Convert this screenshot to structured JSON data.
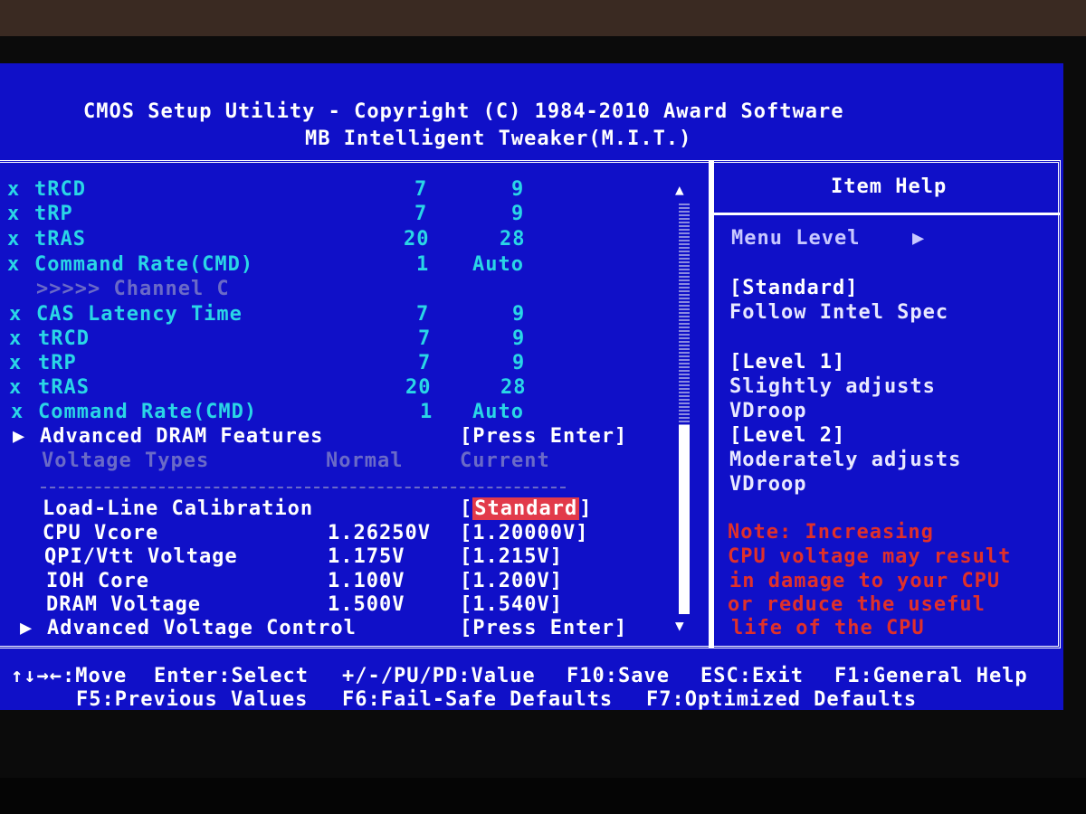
{
  "header": {
    "line1": "CMOS Setup Utility - Copyright (C) 1984-2010 Award Software",
    "line2": "MB Intelligent Tweaker(M.I.T.)"
  },
  "timings_a": [
    {
      "name": "tRCD",
      "normal": "7",
      "current": "9"
    },
    {
      "name": "tRP",
      "normal": "7",
      "current": "9"
    },
    {
      "name": "tRAS",
      "normal": "20",
      "current": "28"
    },
    {
      "name": "Command Rate(CMD)",
      "normal": "1",
      "current": "Auto"
    }
  ],
  "channel_label": ">>>>> Channel C",
  "timings_c": [
    {
      "name": "CAS Latency Time",
      "normal": "7",
      "current": "9"
    },
    {
      "name": "tRCD",
      "normal": "7",
      "current": "9"
    },
    {
      "name": "tRP",
      "normal": "7",
      "current": "9"
    },
    {
      "name": "tRAS",
      "normal": "20",
      "current": "28"
    },
    {
      "name": "Command Rate(CMD)",
      "normal": "1",
      "current": "Auto"
    }
  ],
  "x_mark": "x",
  "submenu_arrow": "▶",
  "adv_dram": {
    "label": "Advanced DRAM Features",
    "value": "[Press Enter]"
  },
  "voltage_header": {
    "types": "Voltage Types",
    "normal": "Normal",
    "current": "Current"
  },
  "voltages": {
    "llc": {
      "label": "Load-Line Calibration",
      "value": "Standard",
      "open": "[",
      "close": "]"
    },
    "vcore": {
      "label": "CPU Vcore",
      "normal": "1.26250V",
      "current": "[1.20000V]"
    },
    "qpi": {
      "label": "QPI/Vtt Voltage",
      "normal": "1.175V",
      "current": "[1.215V]"
    },
    "ioh": {
      "label": "IOH Core",
      "normal": "1.100V",
      "current": "[1.200V]"
    },
    "dram": {
      "label": "DRAM Voltage",
      "normal": "1.500V",
      "current": "[1.540V]"
    }
  },
  "adv_voltage": {
    "label": "Advanced Voltage Control",
    "value": "[Press Enter]"
  },
  "scroll": {
    "up": "▲",
    "down": "▼"
  },
  "help": {
    "title": "Item Help",
    "menu_level": "Menu Level",
    "menu_arrow": "▶",
    "lines": [
      "[Standard]",
      "Follow Intel Spec",
      "[Level 1]",
      "Slightly adjusts",
      "VDroop",
      "[Level 2]",
      "Moderately adjusts",
      "VDroop"
    ],
    "note": [
      "Note: Increasing",
      "CPU voltage may result",
      "in damage to your CPU",
      "or reduce the useful",
      "life of the CPU"
    ]
  },
  "footer": {
    "move": "↑↓→←:Move",
    "select": "Enter:Select",
    "value": "+/-/PU/PD:Value",
    "save": "F10:Save",
    "exit": "ESC:Exit",
    "help": "F1:General Help",
    "prev": "F5:Previous Values",
    "failsafe": "F6:Fail-Safe Defaults",
    "optimized": "F7:Optimized Defaults"
  },
  "colors": {
    "background": "#1010c8",
    "cyan_text": "#2ad6e6",
    "highlight": "#e23a4a",
    "note_text": "#e0302a"
  }
}
